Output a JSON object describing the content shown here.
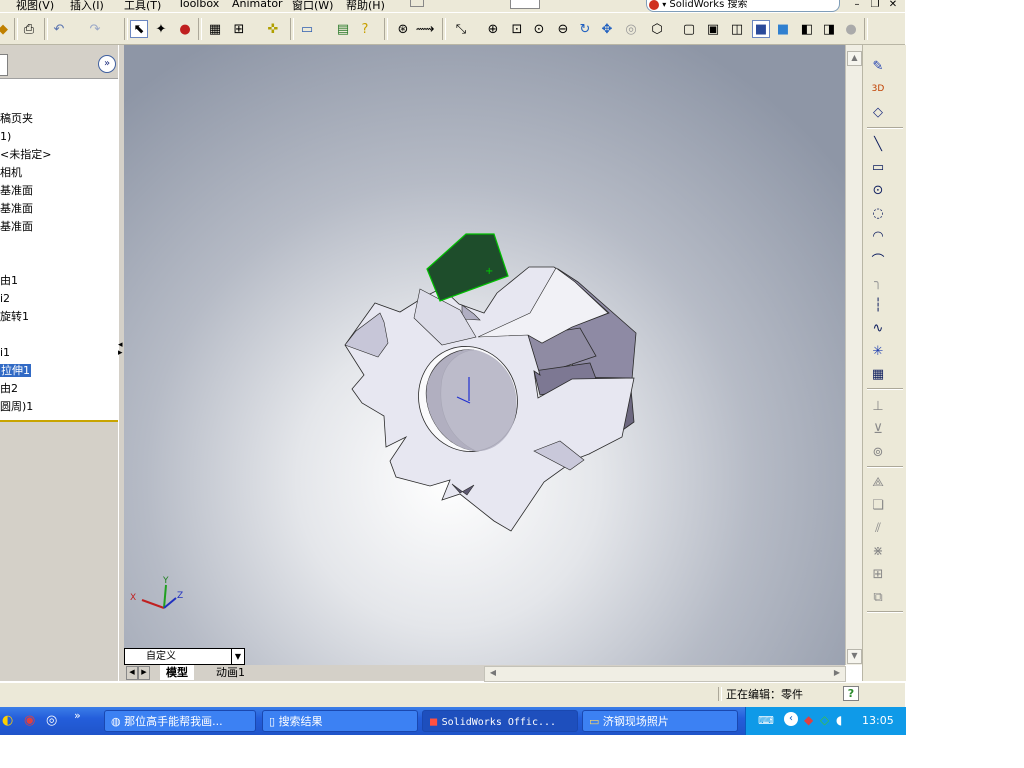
{
  "menubar": {
    "items": [
      "视图(V)",
      "插入(I)",
      "工具(T)",
      "Toolbox",
      "Animator",
      "窗口(W)",
      "帮助(H)"
    ],
    "search_placeholder": "SolidWorks 搜索"
  },
  "tree": {
    "items": [
      {
        "label": "稿页夹",
        "selected": false
      },
      {
        "label": "1)",
        "selected": false
      },
      {
        "label": "<未指定>",
        "selected": false
      },
      {
        "label": "相机",
        "selected": false
      },
      {
        "label": "基准面",
        "selected": false
      },
      {
        "label": "基准面",
        "selected": false
      },
      {
        "label": "基准面",
        "selected": false
      },
      {
        "label": "由1",
        "selected": false
      },
      {
        "label": "i2",
        "selected": false
      },
      {
        "label": "旋转1",
        "selected": false
      },
      {
        "label": "i1",
        "selected": false
      },
      {
        "label": "拉伸1",
        "selected": true
      },
      {
        "label": "由2",
        "selected": false
      },
      {
        "label": "圆周)1",
        "selected": false
      }
    ],
    "expand_label": "»"
  },
  "viewport": {
    "view_orientation": "自定义",
    "tabs": [
      "模型",
      "动画1"
    ],
    "triad": {
      "x_label": "X",
      "y_label": "Y",
      "z_label": "Z"
    }
  },
  "statusbar": {
    "editing_text": "正在编辑：零件",
    "help_label": "?"
  },
  "taskbar": {
    "tasks": [
      {
        "label": "那位高手能帮我画...",
        "active": false
      },
      {
        "label": "搜索结果",
        "active": false
      },
      {
        "label": "SolidWorks Offic...",
        "active": true
      },
      {
        "label": "济钢现场照片",
        "active": false
      }
    ],
    "overflow": "»",
    "clock": "13:05"
  },
  "colors": {
    "selection_face": "#1e4d2b",
    "selection_edge": "#00c000",
    "part_light": "#e8e8f2",
    "part_shadow": "#6d6880",
    "taskbar_blue": "#245edb",
    "tree_selection": "#316ac5"
  }
}
